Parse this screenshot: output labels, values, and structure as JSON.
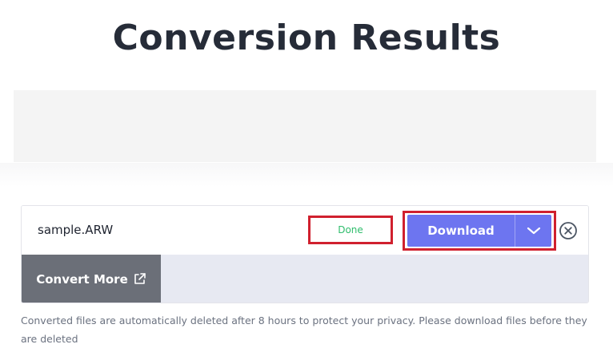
{
  "header": {
    "title": "Conversion Results"
  },
  "file": {
    "name": "sample.ARW",
    "status": "Done",
    "download_label": "Download"
  },
  "actions": {
    "convert_more_label": "Convert More"
  },
  "footer": {
    "privacy_note": "Converted files are automatically deleted after 8 hours to protect your privacy. Please download files before they are deleted"
  },
  "icons": {
    "dropdown": "chevron-down-icon",
    "remove": "close-circle-icon",
    "external": "external-link-icon"
  },
  "colors": {
    "title": "#262c38",
    "accent": "#6d75f0",
    "status_done": "#2fbd6c",
    "highlight": "#d0202e",
    "convert_more_bg": "#6b6f78",
    "actions_bg": "#e7e9f2"
  }
}
